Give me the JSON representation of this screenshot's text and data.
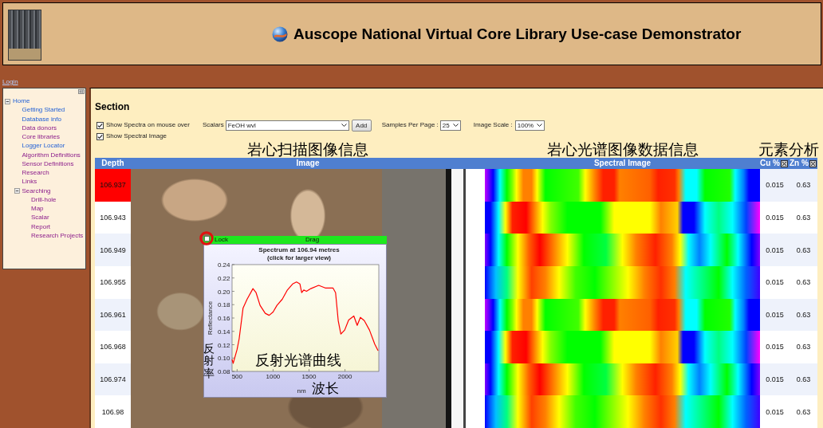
{
  "header": {
    "title": "Auscope National Virtual Core Library Use-case Demonstrator"
  },
  "login_link": "Login",
  "sidebar": {
    "items": [
      {
        "label": "Home",
        "visited": false,
        "expanded": true,
        "children": [
          {
            "label": "Getting Started",
            "visited": false
          },
          {
            "label": "Database info",
            "visited": false
          },
          {
            "label": "Data donors",
            "visited": true
          },
          {
            "label": "Core libraries",
            "visited": true
          },
          {
            "label": "Logger Locator",
            "visited": false
          },
          {
            "label": "Algorithm Definitions",
            "visited": true
          },
          {
            "label": "Sensor Definitions",
            "visited": true
          },
          {
            "label": "Research",
            "visited": true
          },
          {
            "label": "Links",
            "visited": true
          },
          {
            "label": "Searching",
            "visited": true,
            "expanded": true,
            "children": [
              {
                "label": "Drill-hole",
                "visited": true
              },
              {
                "label": "Map",
                "visited": true
              },
              {
                "label": "Scalar",
                "visited": true
              },
              {
                "label": "Report",
                "visited": true
              },
              {
                "label": "Research Projects",
                "visited": true
              }
            ]
          }
        ]
      }
    ]
  },
  "section": {
    "title": "Section",
    "options": [
      {
        "label": "Show Spectra on mouse over",
        "checked": true
      },
      {
        "label": "Show Spectral Image",
        "checked": true
      }
    ],
    "scalars": {
      "label": "Scalars",
      "value": "FeOH wvl"
    },
    "add_button": "Add",
    "samples_per_page": {
      "label": "Samples Per Page :",
      "value": "25"
    },
    "image_scale": {
      "label": "Image Scale :",
      "value": "100%"
    }
  },
  "annotations": [
    "岩心扫描图像信息",
    "岩心光谱图像数据信息",
    "元素分析"
  ],
  "table": {
    "columns": [
      {
        "label": "Depth",
        "removable": false
      },
      {
        "label": "Image",
        "removable": false
      },
      {
        "label": "Spectral Image",
        "removable": false
      },
      {
        "label": "Cu %",
        "removable": true
      },
      {
        "label": "Zn %",
        "removable": true
      }
    ],
    "rows": [
      {
        "depth": "106.937",
        "selected": true,
        "cu": "0.015",
        "zn": "0.63"
      },
      {
        "depth": "106.943",
        "selected": false,
        "cu": "0.015",
        "zn": "0.63"
      },
      {
        "depth": "106.949",
        "selected": false,
        "cu": "0.015",
        "zn": "0.63"
      },
      {
        "depth": "106.955",
        "selected": false,
        "cu": "0.015",
        "zn": "0.63"
      },
      {
        "depth": "106.961",
        "selected": false,
        "cu": "0.015",
        "zn": "0.63"
      },
      {
        "depth": "106.968",
        "selected": false,
        "cu": "0.015",
        "zn": "0.63"
      },
      {
        "depth": "106.974",
        "selected": false,
        "cu": "0.015",
        "zn": "0.63"
      },
      {
        "depth": "106.98",
        "selected": false,
        "cu": "0.015",
        "zn": "0.63"
      }
    ]
  },
  "spectrum_popup": {
    "lock": {
      "label": "Lock",
      "checked": false
    },
    "drag_label": "Drag",
    "subtitle": "(click for larger view)",
    "chart_data": {
      "type": "line",
      "title": "Spectrum at 106.94 metres",
      "xlabel": "nm",
      "ylabel": "Reflectance",
      "x": [
        430,
        446,
        500,
        529,
        583,
        638,
        721,
        764,
        819,
        891,
        946,
        1000,
        1054,
        1127,
        1199,
        1272,
        1326,
        1373,
        1398,
        1427,
        1464,
        1525,
        1634,
        1725,
        1833,
        1869,
        1906,
        1942,
        1996,
        2051,
        2123,
        2170,
        2214,
        2268,
        2340,
        2413,
        2460
      ],
      "series": [
        {
          "color": "#ff0000",
          "values": [
            0.098,
            0.092,
            0.113,
            0.129,
            0.175,
            0.188,
            0.204,
            0.198,
            0.179,
            0.167,
            0.164,
            0.169,
            0.179,
            0.188,
            0.202,
            0.211,
            0.214,
            0.211,
            0.198,
            0.202,
            0.2,
            0.204,
            0.209,
            0.205,
            0.205,
            0.198,
            0.156,
            0.136,
            0.142,
            0.157,
            0.163,
            0.149,
            0.161,
            0.156,
            0.142,
            0.121,
            0.111
          ]
        }
      ],
      "xlim": [
        430,
        2470
      ],
      "ylim": [
        0.08,
        0.24
      ],
      "xticks": [
        500,
        1000,
        1500,
        2000
      ],
      "yticks": [
        {
          "value": 0.08,
          "label": "0.08"
        },
        {
          "value": 0.1,
          "label": "0.10"
        },
        {
          "value": 0.12,
          "label": "0.12"
        },
        {
          "value": 0.14,
          "label": "0.14"
        },
        {
          "value": 0.16,
          "label": "0.16"
        },
        {
          "value": 0.18,
          "label": "0.18"
        },
        {
          "value": 0.2,
          "label": "0.20"
        },
        {
          "value": 0.22,
          "label": "0.22"
        },
        {
          "value": 0.24,
          "label": "0.24"
        }
      ]
    },
    "annotations": [
      {
        "kind": "vertical",
        "text": "反射率"
      },
      {
        "kind": "caption",
        "text": "反射光谱曲线"
      },
      {
        "kind": "axis",
        "text": "波长"
      }
    ]
  }
}
